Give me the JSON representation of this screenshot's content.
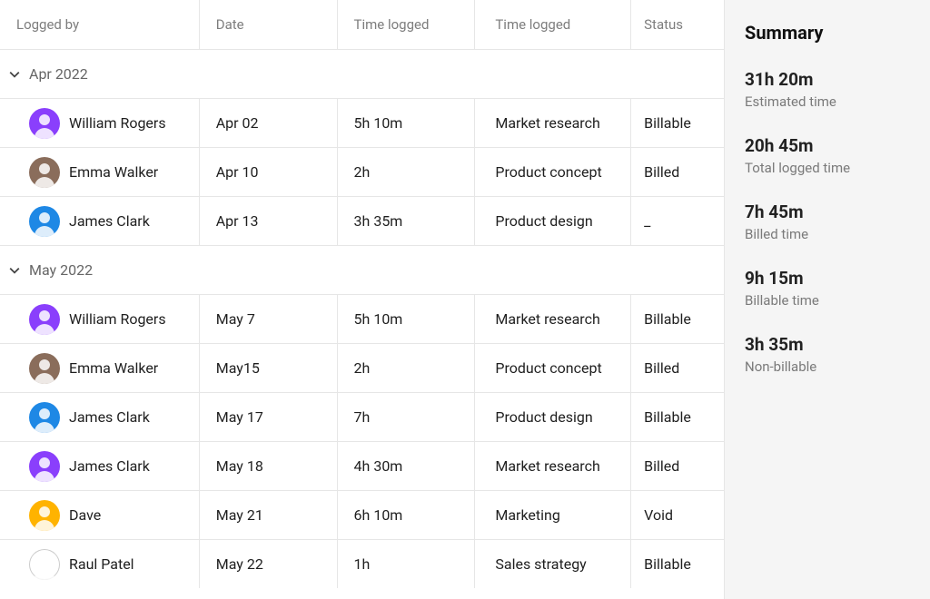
{
  "columns": {
    "logged_by": "Logged by",
    "date": "Date",
    "time_logged_a": "Time logged",
    "time_logged_b": "Time logged",
    "status": "Status"
  },
  "groups": [
    {
      "label": "Apr 2022",
      "rows": [
        {
          "avatar_color": "#8a3ffc",
          "name": "William Rogers",
          "date": "Apr 02",
          "time": "5h 10m",
          "tag": "Market research",
          "status": "Billable"
        },
        {
          "avatar_color": "#8a6d5b",
          "name": "Emma Walker",
          "date": "Apr  10",
          "time": "2h",
          "tag": "Product concept",
          "status": "Billed"
        },
        {
          "avatar_color": "#1e88e5",
          "name": "James Clark",
          "date": "Apr  13",
          "time": "3h 35m",
          "tag": "Product design",
          "status": "_"
        }
      ]
    },
    {
      "label": "May 2022",
      "rows": [
        {
          "avatar_color": "#8a3ffc",
          "name": "William Rogers",
          "date": "May 7",
          "time": "5h 10m",
          "tag": "Market research",
          "status": "Billable"
        },
        {
          "avatar_color": "#8a6d5b",
          "name": "Emma Walker",
          "date": "May15",
          "time": "2h",
          "tag": "Product concept",
          "status": "Billed"
        },
        {
          "avatar_color": "#1e88e5",
          "name": "James Clark",
          "date": "May 17",
          "time": "7h",
          "tag": "Product design",
          "status": "Billable"
        },
        {
          "avatar_color": "#8a3ffc",
          "name": "James Clark",
          "date": "May 18",
          "time": "4h 30m",
          "tag": "Market research",
          "status": "Billed"
        },
        {
          "avatar_color": "#ffb300",
          "name": "Dave",
          "date": "May 21",
          "time": "6h 10m",
          "tag": "Marketing",
          "status": "Void"
        },
        {
          "avatar_color": "#ffffff",
          "name": "Raul Patel",
          "date": "May 22",
          "time": "1h",
          "tag": "Sales strategy",
          "status": "Billable"
        }
      ]
    }
  ],
  "summary": {
    "title": "Summary",
    "items": [
      {
        "value": "31h 20m",
        "label": "Estimated time"
      },
      {
        "value": "20h 45m",
        "label": "Total logged time"
      },
      {
        "value": "7h 45m",
        "label": "Billed time"
      },
      {
        "value": "9h 15m",
        "label": "Billable time"
      },
      {
        "value": "3h 35m",
        "label": "Non-billable"
      }
    ]
  }
}
